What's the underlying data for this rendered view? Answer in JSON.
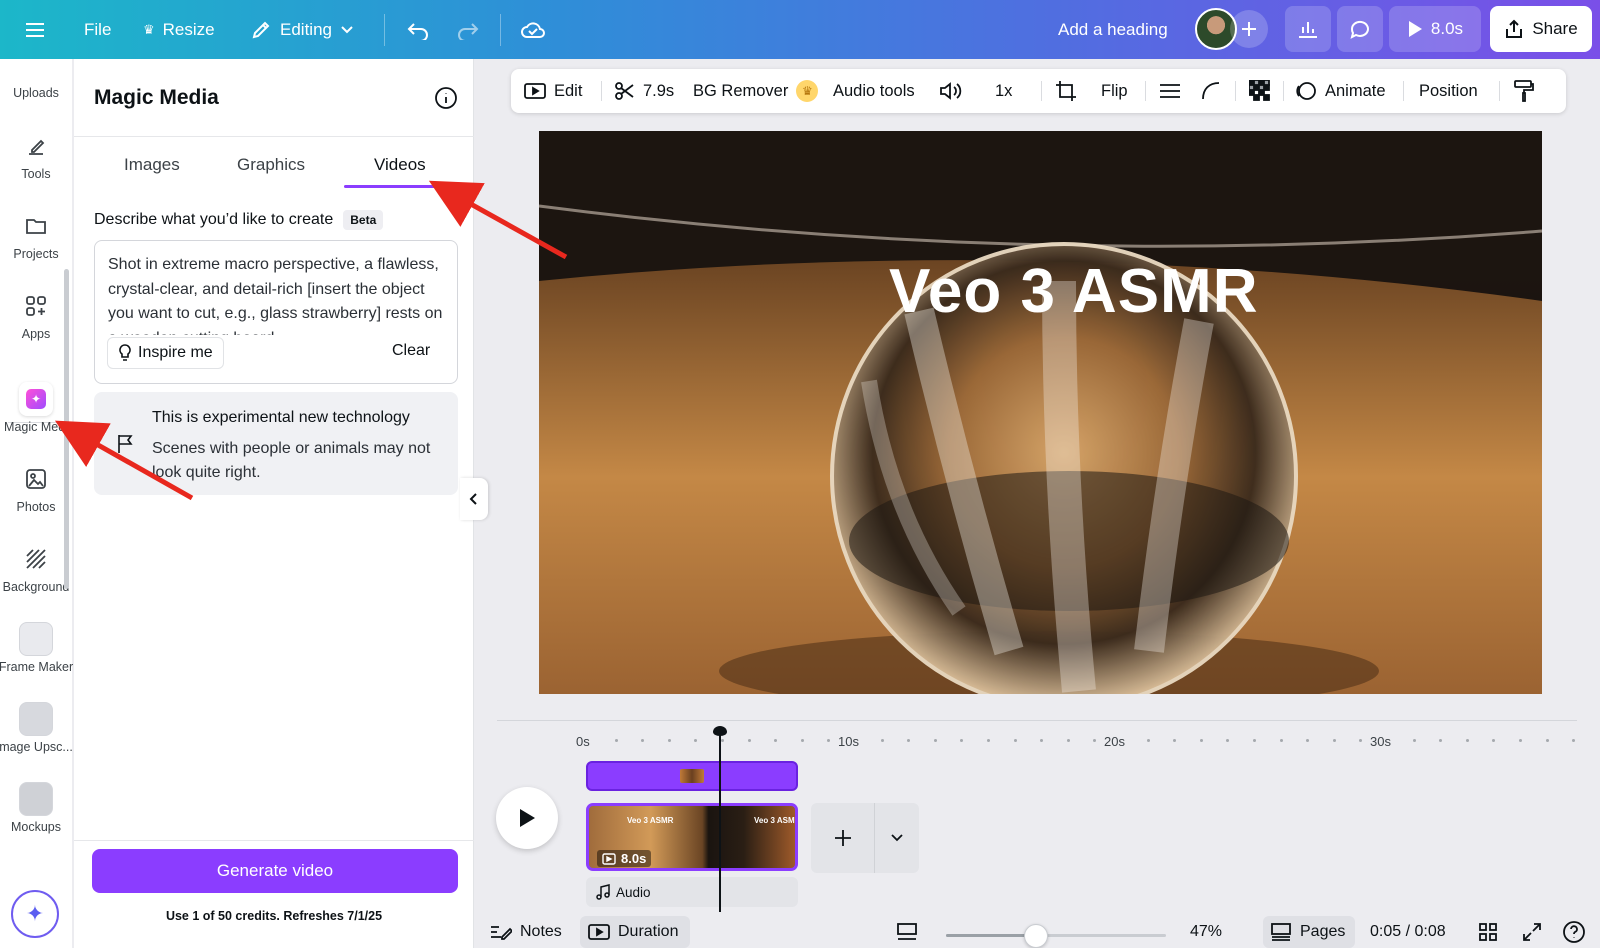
{
  "topbar": {
    "file": "File",
    "resize": "Resize",
    "editing": "Editing",
    "heading": "Add a heading",
    "play_duration": "8.0s",
    "share": "Share"
  },
  "rail": {
    "items": [
      {
        "label": "Uploads"
      },
      {
        "label": "Tools"
      },
      {
        "label": "Projects"
      },
      {
        "label": "Apps"
      },
      {
        "label": "Magic Medi"
      },
      {
        "label": "Photos"
      },
      {
        "label": "Background"
      },
      {
        "label": "Frame Maker"
      },
      {
        "label": "mage Upsc..."
      },
      {
        "label": "Mockups"
      }
    ]
  },
  "panel": {
    "title": "Magic Media",
    "tabs": [
      {
        "label": "Images"
      },
      {
        "label": "Graphics"
      },
      {
        "label": "Videos"
      }
    ],
    "desc_label": "Describe what you’d like to create",
    "beta": "Beta",
    "prompt": "Shot in extreme macro perspective, a flawless, crystal-clear, and detail-rich [insert the object you want to cut, e.g., glass strawberry] rests on a wooden cutting board",
    "inspire": "Inspire me",
    "clear": "Clear",
    "notice_title": "This is experimental new technology",
    "notice_body": "Scenes with people or animals may not look quite right.",
    "generate": "Generate video",
    "credits": "Use 1 of 50 credits. Refreshes 7/1/25"
  },
  "ctx_toolbar": {
    "edit": "Edit",
    "trim": "7.9s",
    "bg_remover": "BG Remover",
    "audio_tools": "Audio tools",
    "speed": "1x",
    "flip": "Flip",
    "animate": "Animate",
    "position": "Position"
  },
  "canvas": {
    "title": "Veo 3 ASMR"
  },
  "timeline": {
    "ticks": [
      "0s",
      "10s",
      "20s",
      "30s"
    ],
    "clip_duration": "8.0s",
    "clip_text": "Veo 3 ASMR",
    "clip_text_2": "Veo 3 ASM",
    "audio": "Audio"
  },
  "bottombar": {
    "notes": "Notes",
    "duration": "Duration",
    "zoom": "47%",
    "pages": "Pages",
    "time": "0:05 / 0:08"
  },
  "colors": {
    "accent": "#8b3dff",
    "annotation_arrow": "#e8281e"
  }
}
